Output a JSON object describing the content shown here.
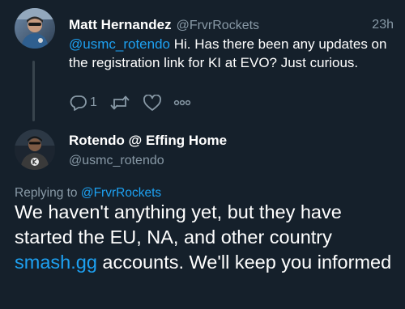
{
  "colors": {
    "background": "#15202b",
    "text": "#ffffff",
    "muted": "#8899a6",
    "link": "#1da1f2",
    "thread_line": "#38444d"
  },
  "parent_tweet": {
    "author_name": "Matt Hernandez",
    "author_handle": "@FrvrRockets",
    "time": "23h",
    "mention": "@usmc_rotendo",
    "text": " Hi. Has there been any updates on the registration link for KI at EVO? Just curious.",
    "actions": {
      "reply_icon": "reply-icon",
      "reply_count": "1",
      "retweet_icon": "retweet-icon",
      "like_icon": "like-icon",
      "more_icon": "more-icon"
    }
  },
  "reply_tweet": {
    "author_name": "Rotendo @ Effing Home",
    "author_handle": "@usmc_rotendo",
    "replying_to_label": "Replying to ",
    "replying_to_handle": "@FrvrRockets",
    "text_part1": "We haven't anything yet, but they have started the EU, NA, and other country ",
    "link_text": "smash.gg",
    "text_part2": " accounts. We'll keep you informed"
  }
}
